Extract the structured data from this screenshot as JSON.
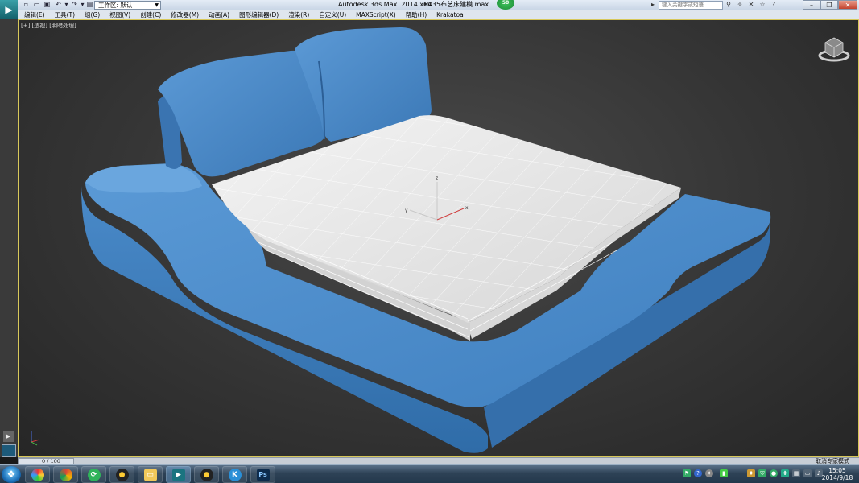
{
  "titlebar": {
    "workspace": "工作区: 默认",
    "title": "Autodesk 3ds Max  2014 x64",
    "file": "P035布艺床建模.max",
    "badge": "58",
    "search_placeholder": "键入关键字或短语"
  },
  "menu": [
    "编辑(E)",
    "工具(T)",
    "组(G)",
    "视图(V)",
    "创建(C)",
    "修改器(M)",
    "动画(A)",
    "图形编辑器(D)",
    "渲染(R)",
    "自定义(U)",
    "MAXScript(X)",
    "帮助(H)",
    "Krakatoa"
  ],
  "viewport": {
    "label": "[+] [透视] [明暗处理]",
    "axis_x": "x",
    "axis_y": "y",
    "axis_z": "z"
  },
  "timeline": {
    "frame": "0 / 100",
    "status": "取消专家模式"
  },
  "clock": {
    "time": "15:05",
    "date": "2014/9/18"
  },
  "colors": {
    "bed_blue": "#4a87c7",
    "mattress": "#e6e6e6",
    "viewport_border": "#d8c85a"
  },
  "taskbar_icons": [
    "windows-start-icon",
    "pinwheel-icon",
    "chrome-icon",
    "sync-icon",
    "qq-icon",
    "folder-icon",
    "3dsmax-icon",
    "qq-icon-2",
    "k-icon",
    "photoshop-icon"
  ]
}
